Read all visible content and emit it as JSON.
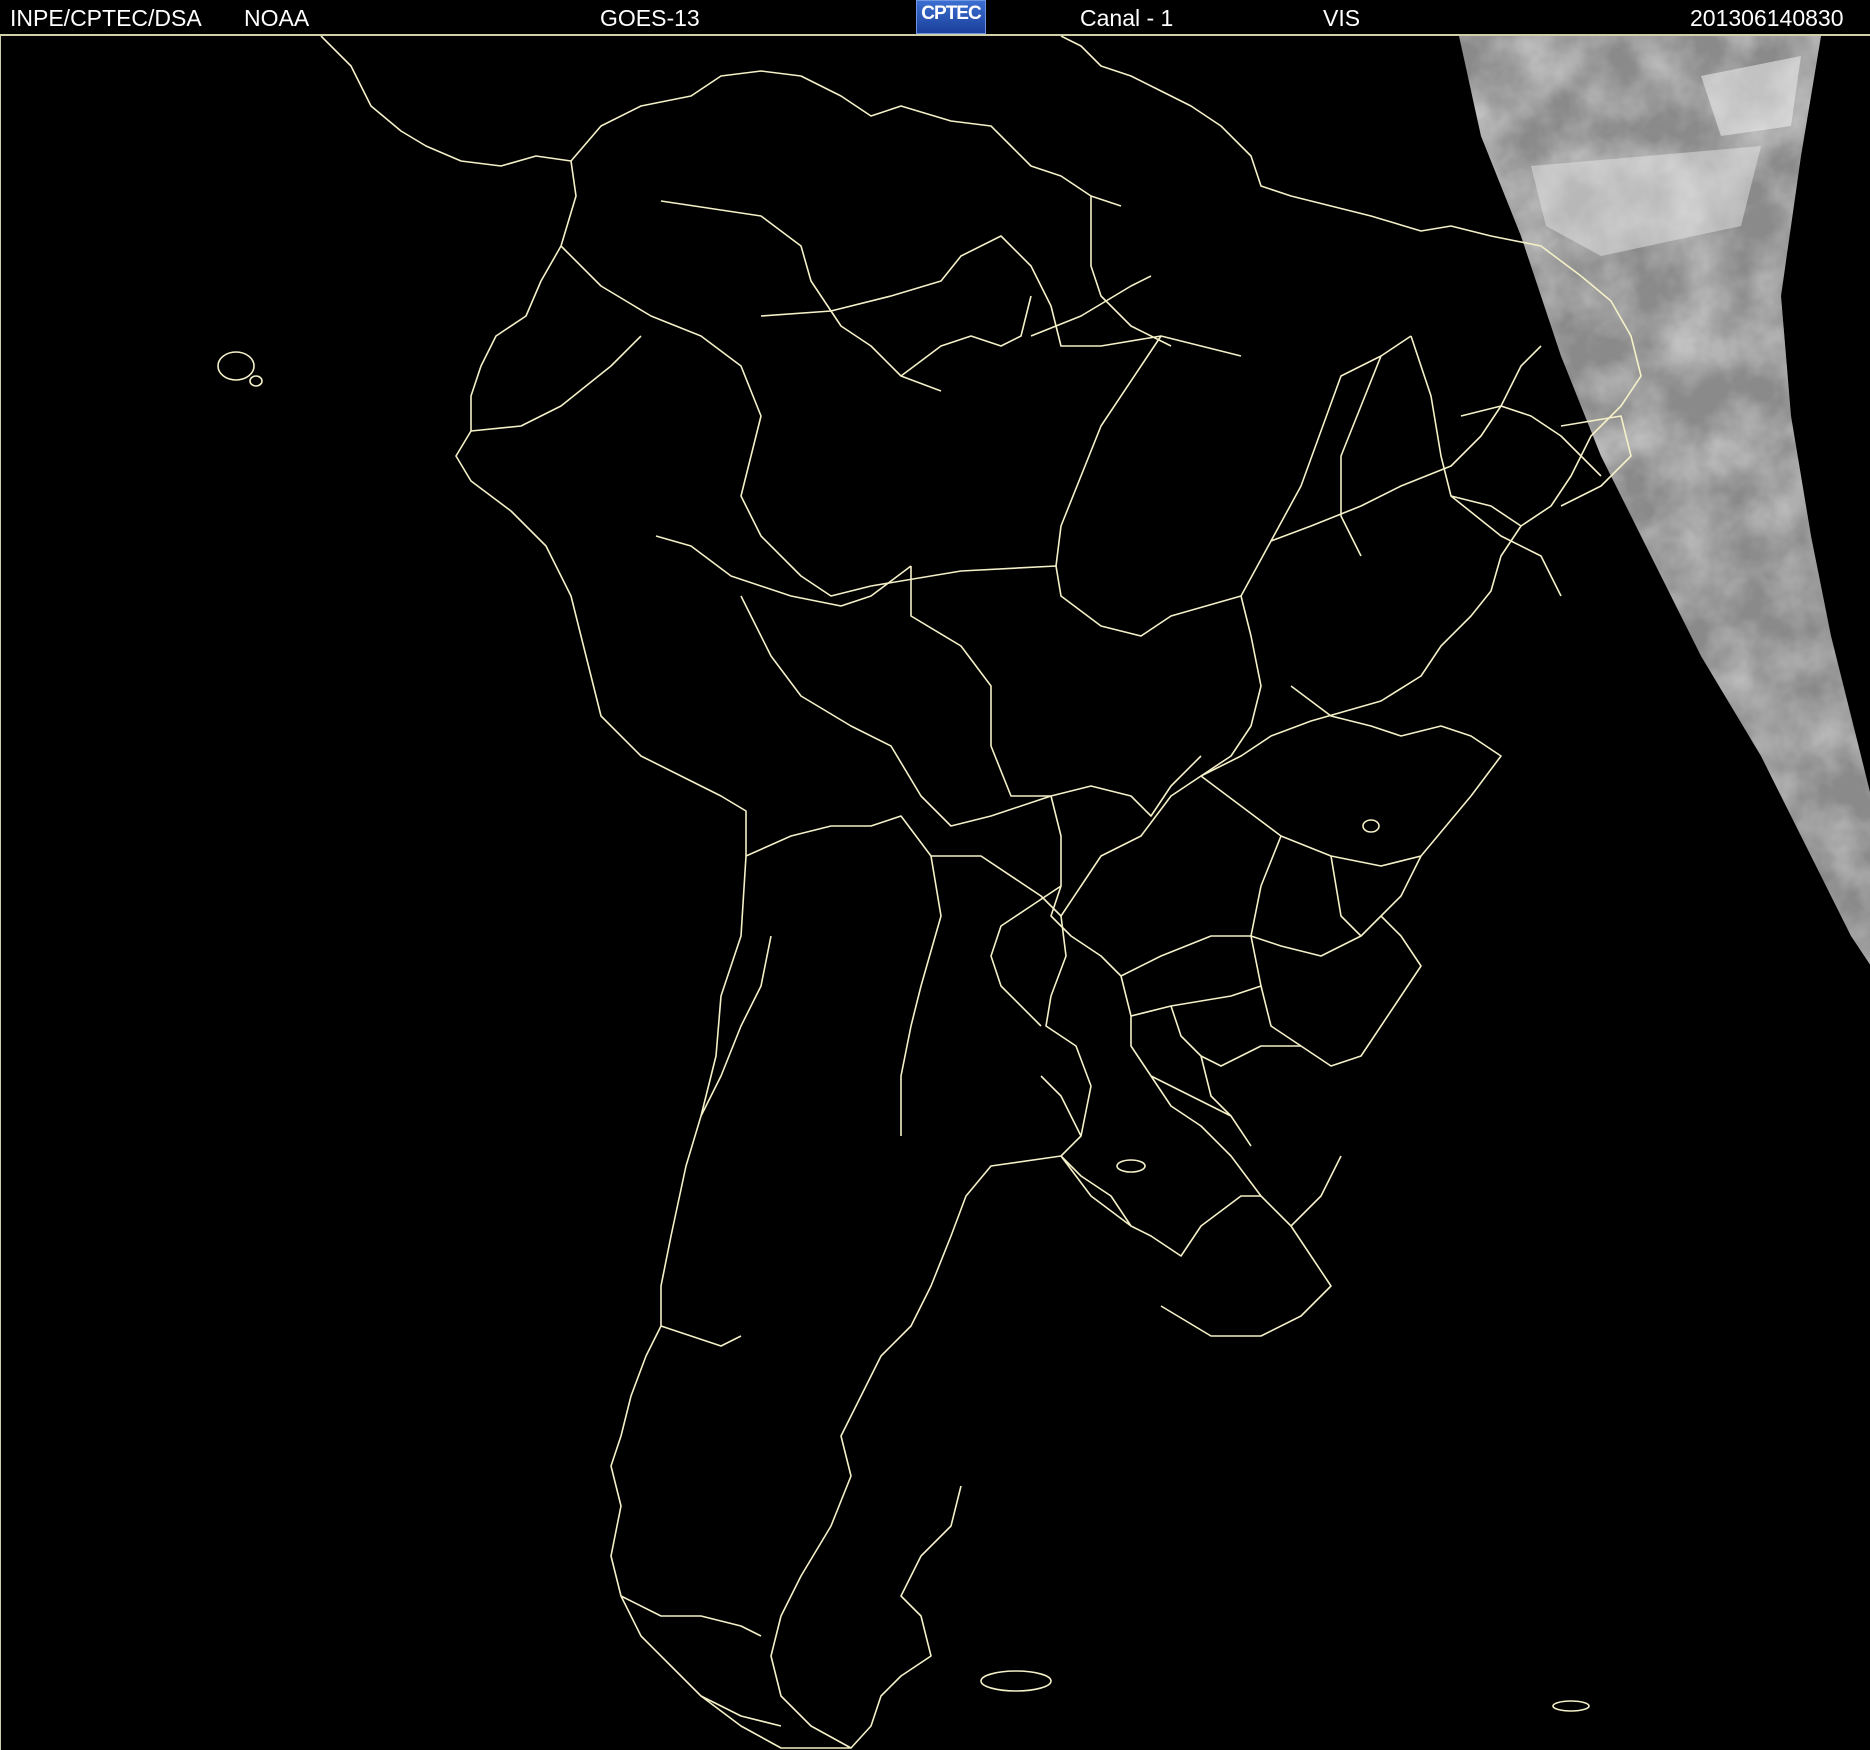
{
  "header": {
    "agency": "INPE/CPTEC/DSA",
    "source": "NOAA",
    "satellite": "GOES-13",
    "logo_text": "CPTEC",
    "channel": "Canal - 1",
    "band": "VIS",
    "timestamp": "201306140830"
  },
  "colors": {
    "background": "#000000",
    "borders": "#f4f0c8",
    "header_text": "#ffffff",
    "logo": "#2a56b8",
    "cloud_imagery": "#b8b8b8"
  },
  "map": {
    "region": "South America",
    "layers": [
      "country-borders",
      "state-borders",
      "coastline",
      "visible-cloud-imagery"
    ]
  }
}
